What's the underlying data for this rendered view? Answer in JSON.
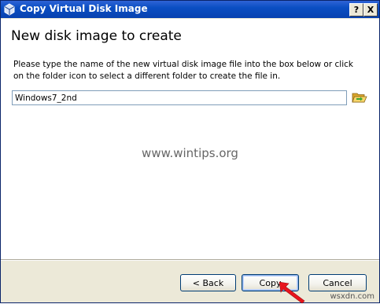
{
  "window": {
    "title": "Copy Virtual Disk Image",
    "help_label": "?",
    "close_label": "X"
  },
  "page": {
    "heading": "New disk image to create",
    "instructions": "Please type the name of the new virtual disk image file into the box below or click on the folder icon to select a different folder to create the file in.",
    "filename_value": "Windows7_2nd",
    "watermark": "www.wintips.org"
  },
  "buttons": {
    "back_label": "< Back",
    "copy_label": "Copy",
    "cancel_label": "Cancel"
  },
  "site_mark": "wsxdn.com",
  "icons": {
    "app": "virtualbox-icon",
    "folder": "folder-open-icon",
    "pointer": "red-arrow-icon"
  },
  "colors": {
    "titlebar": "#0a4ec2",
    "arrow": "#e8141c",
    "folder": "#f2c744"
  }
}
